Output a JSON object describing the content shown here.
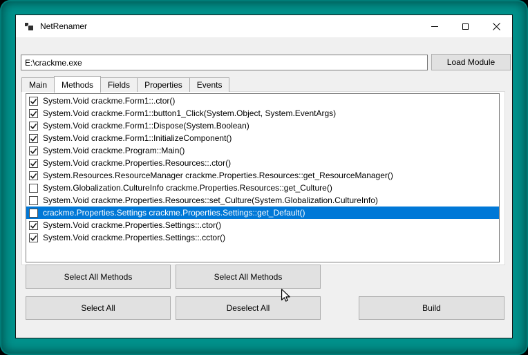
{
  "window": {
    "title": "NetRenamer",
    "controls": {
      "minimize": "minimize",
      "maximize": "maximize",
      "close": "close"
    }
  },
  "toolbar": {
    "module_path": "E:\\crackme.exe",
    "load_button": "Load Module"
  },
  "tabs": [
    {
      "label": "Main",
      "active": false
    },
    {
      "label": "Methods",
      "active": true
    },
    {
      "label": "Fields",
      "active": false
    },
    {
      "label": "Properties",
      "active": false
    },
    {
      "label": "Events",
      "active": false
    }
  ],
  "methods": {
    "items": [
      {
        "text": "System.Void crackme.Form1::.ctor()",
        "checked": true,
        "selected": false
      },
      {
        "text": "System.Void crackme.Form1::button1_Click(System.Object, System.EventArgs)",
        "checked": true,
        "selected": false
      },
      {
        "text": "System.Void crackme.Form1::Dispose(System.Boolean)",
        "checked": true,
        "selected": false
      },
      {
        "text": "System.Void crackme.Form1::InitializeComponent()",
        "checked": true,
        "selected": false
      },
      {
        "text": "System.Void crackme.Program::Main()",
        "checked": true,
        "selected": false
      },
      {
        "text": "System.Void crackme.Properties.Resources::.ctor()",
        "checked": true,
        "selected": false
      },
      {
        "text": "System.Resources.ResourceManager crackme.Properties.Resources::get_ResourceManager()",
        "checked": true,
        "selected": false
      },
      {
        "text": "System.Globalization.CultureInfo crackme.Properties.Resources::get_Culture()",
        "checked": false,
        "selected": false
      },
      {
        "text": "System.Void crackme.Properties.Resources::set_Culture(System.Globalization.CultureInfo)",
        "checked": false,
        "selected": false
      },
      {
        "text": "crackme.Properties.Settings crackme.Properties.Settings::get_Default()",
        "checked": false,
        "selected": true
      },
      {
        "text": "System.Void crackme.Properties.Settings::.ctor()",
        "checked": true,
        "selected": false
      },
      {
        "text": "System.Void crackme.Properties.Settings::.cctor()",
        "checked": true,
        "selected": false
      }
    ]
  },
  "actions": [
    {
      "label": "Select All Methods"
    },
    {
      "label": "Select All Methods"
    },
    {
      "label": "Select All"
    },
    {
      "label": "Deselect All"
    },
    {
      "label": "Build"
    }
  ],
  "colors": {
    "selection": "#0078d7",
    "desktop": "#00918b",
    "titlebar": "#ffffff",
    "client": "#f0f0f0",
    "button_face": "#e1e1e1"
  }
}
